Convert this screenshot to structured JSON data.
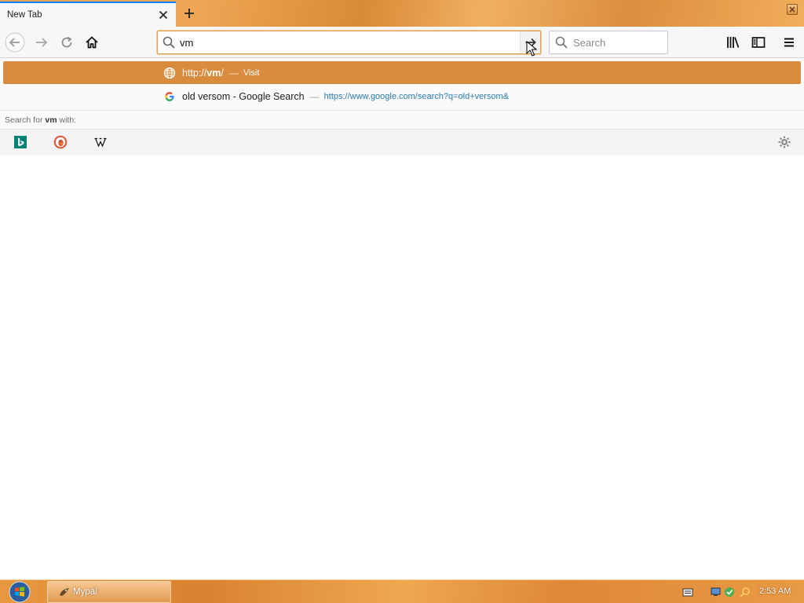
{
  "tab": {
    "title": "New Tab"
  },
  "urlbar": {
    "value": "vm"
  },
  "searchbar": {
    "placeholder": "Search"
  },
  "autocomplete": {
    "selected": {
      "prefix": "http://",
      "bold": "vm",
      "suffix": "/",
      "separator": "—",
      "action": "Visit"
    },
    "suggestion": {
      "title": "old versom - Google Search",
      "separator": "—",
      "url": "https://www.google.com/search?q=old+versom&"
    },
    "oneoff": {
      "prefix": "Search for",
      "query": "vm",
      "suffix": "with:",
      "engines": [
        "Bing",
        "DuckDuckGo",
        "Wikipedia"
      ]
    }
  },
  "taskbar": {
    "task_label": "Mypal",
    "clock": "2:53 AM"
  },
  "colors": {
    "accent": "#d98b3e",
    "focus_ring": "#e0a055",
    "url_blue": "#2a7ab0",
    "tab_highlight": "#0a84ff"
  }
}
